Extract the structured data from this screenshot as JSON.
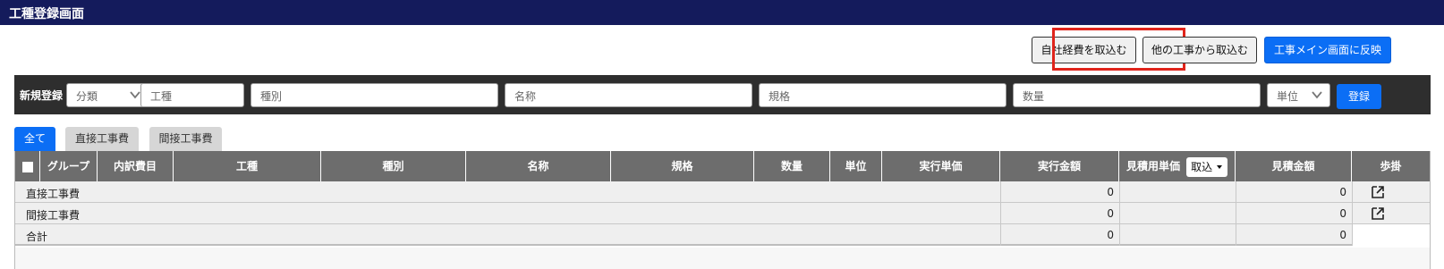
{
  "window": {
    "title": "工種登録画面"
  },
  "toolbar": {
    "import_own_expense": "自社経費を取込む",
    "import_from_other": "他の工事から取込む",
    "reflect_main": "工事メイン画面に反映"
  },
  "new_entry": {
    "label": "新規登録",
    "category_select": "分類",
    "koushu_placeholder": "工種",
    "shubetsu_placeholder": "種別",
    "name_placeholder": "名称",
    "spec_placeholder": "規格",
    "qty_placeholder": "数量",
    "unit_select": "単位",
    "register_button": "登録"
  },
  "tabs": [
    {
      "label": "全て",
      "active": true
    },
    {
      "label": "直接工事費",
      "active": false
    },
    {
      "label": "間接工事費",
      "active": false
    }
  ],
  "table": {
    "headers": {
      "group": "グループ",
      "breakdown": "内訳費目",
      "koushu": "工種",
      "shubetsu": "種別",
      "name": "名称",
      "spec": "規格",
      "qty": "数量",
      "unit": "単位",
      "exec_unit_price": "実行単価",
      "exec_amount": "実行金額",
      "estimate_unit_price": "見積用単価",
      "import_dropdown": "取込",
      "estimate_amount": "見積金額",
      "rate": "歩掛"
    },
    "rows": [
      {
        "label": "直接工事費",
        "exec_amount": "0",
        "estimate_amount": "0"
      },
      {
        "label": "間接工事費",
        "exec_amount": "0",
        "estimate_amount": "0"
      },
      {
        "label": "合計",
        "exec_amount": "0",
        "estimate_amount": "0"
      }
    ]
  },
  "icons": {
    "checkbox": "checkbox-icon",
    "chevron": "chevron-down-icon",
    "external": "external-link-icon",
    "caret": "caret-down-icon"
  },
  "colors": {
    "titlebar": "#141b5c",
    "primary": "#0b6ef5",
    "highlight": "#e0241b",
    "header_bg": "#6d6d6d",
    "regbar_bg": "#2e2e2e"
  }
}
